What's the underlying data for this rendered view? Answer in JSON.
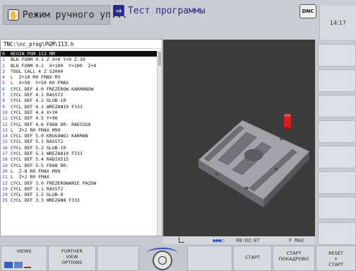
{
  "header": {
    "mode_label": "Режим ручного уп...",
    "program_label": "Тест программы",
    "dnc_label": "DNC",
    "clock": "14:17"
  },
  "program": {
    "path": "TNC:\\nc_prog\\PGM\\113.h",
    "selected_index": 0,
    "lines": [
      {
        "num": "0",
        "code": "BEGIN PGM 113 MM"
      },
      {
        "num": "1",
        "code": "BLK FORM 0.1 Z X+0 Y+0 Z-20"
      },
      {
        "num": "2",
        "code": "BLK FORM 0.2  X+100  Y+100  Z+0"
      },
      {
        "num": "3",
        "code": "TOOL CALL 4 Z S2000"
      },
      {
        "num": "4",
        "code": "L  Z+10 R0 FMAX M3"
      },
      {
        "num": "5",
        "code": "L  X+50  Y+50 R0 FMAX"
      },
      {
        "num": "6",
        "code": "CYCL DEF 4.0 FREZEROW.KARMANOW"
      },
      {
        "num": "7",
        "code": "CYCL DEF 4.1 RASST2"
      },
      {
        "num": "8",
        "code": "CYCL DEF 4.2 GLUB-10"
      },
      {
        "num": "9",
        "code": "CYCL DEF 4.3 WREZAN10 F333"
      },
      {
        "num": "10",
        "code": "CYCL DEF 4.4 X+30"
      },
      {
        "num": "11",
        "code": "CYCL DEF 4.5 Y+90"
      },
      {
        "num": "12",
        "code": "CYCL DEF 4.6 F888 DR- RADIUS8"
      },
      {
        "num": "13",
        "code": "L  Z+2 R0 FMAX M99"
      },
      {
        "num": "14",
        "code": "CYCL DEF 5.0 KRUGOWOJ KARMAN"
      },
      {
        "num": "15",
        "code": "CYCL DEF 5.1 RASST2"
      },
      {
        "num": "16",
        "code": "CYCL DEF 5.2 GLUB-10"
      },
      {
        "num": "17",
        "code": "CYCL DEF 5.3 WREZAN10 F333"
      },
      {
        "num": "18",
        "code": "CYCL DEF 5.4 RADIUS15"
      },
      {
        "num": "19",
        "code": "CYCL DEF 5.5 F888 DR-"
      },
      {
        "num": "20",
        "code": "L  Z-8 R0 FMAX M99"
      },
      {
        "num": "21",
        "code": "L  Z+2 R0 FMAX"
      },
      {
        "num": "22",
        "code": "CYCL DEF 3.0 FREZEROWANIE PAZOW"
      },
      {
        "num": "23",
        "code": "CYCL DEF 3.1 RASST2"
      },
      {
        "num": "24",
        "code": "CYCL DEF 3.2 GLUB-8"
      },
      {
        "num": "25",
        "code": "CYCL DEF 3.3 WREZAN8 F333"
      }
    ]
  },
  "graphic_status": {
    "time": "00:02:07",
    "feed": "F MAX"
  },
  "softkeys": {
    "views": "VIEWS",
    "further_line1": "FURTHER",
    "further_line2": "VIEW",
    "further_line3": "OPTIONS",
    "start": "СТАРТ",
    "start_block_line1": "СТАРТ",
    "start_block_line2": "ПОКАДРОВО",
    "reset_line1": "RESET",
    "reset_line2": "+",
    "reset_line3": "СТАРТ"
  },
  "colors": {
    "line_number": "#2a38c8",
    "selected_bg": "#111111",
    "graphic_bg": "#3b3b3b",
    "workpiece": "#9a9aa0",
    "tool": "#e01a1a"
  }
}
